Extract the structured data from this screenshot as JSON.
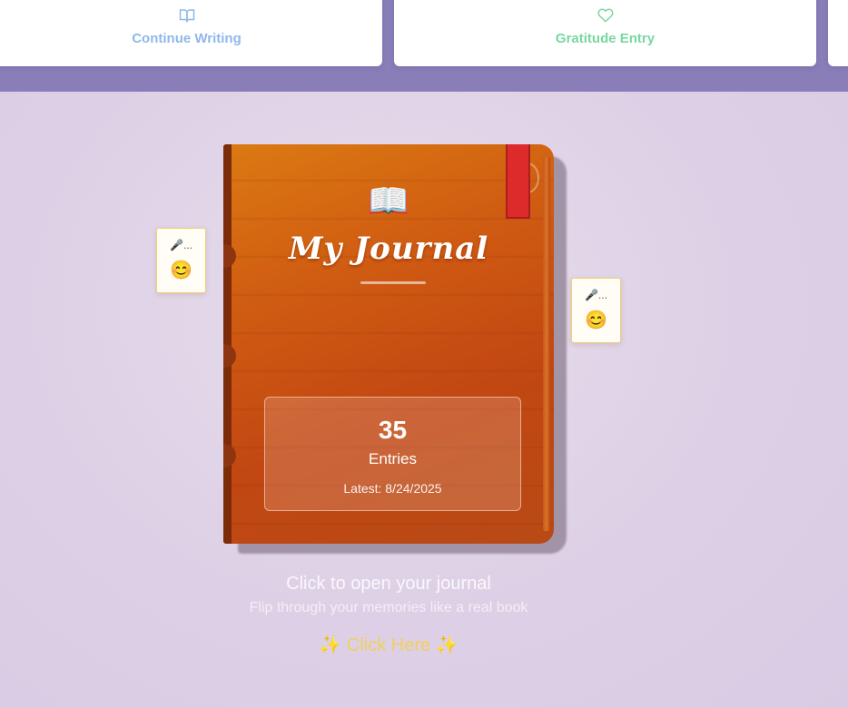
{
  "quick_actions": [
    {
      "label": "Continue Writing",
      "icon": "book-open-icon",
      "color": "#8fb8ea"
    },
    {
      "label": "Gratitude Entry",
      "icon": "heart-icon",
      "color": "#79d8a0"
    }
  ],
  "journal": {
    "icon": "📖",
    "title": "My Journal",
    "entry_count": "35",
    "entries_label": "Entries",
    "latest": "Latest: 8/24/2025"
  },
  "notes": [
    {
      "text": "🎤...",
      "emoji": "😊"
    },
    {
      "text": "🎤...",
      "emoji": "😊"
    }
  ],
  "prompt": {
    "title": "Click to open your journal",
    "subtitle": "Flip through your memories like a real book",
    "click_label": "✨ Click Here ✨"
  },
  "colors": {
    "cover": "#c9520f",
    "bookmark": "#dd2a2b",
    "accent_gold": "#f4cf5b"
  }
}
